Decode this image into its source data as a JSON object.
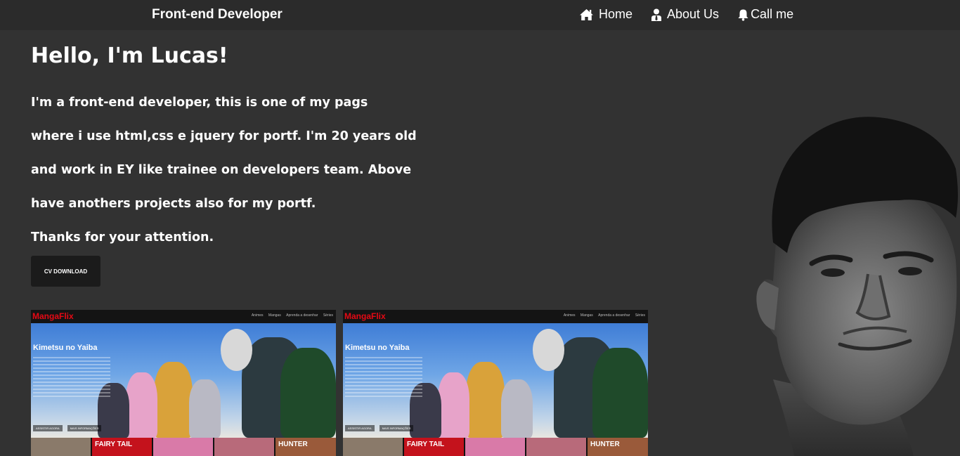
{
  "nav": {
    "brand": "Front-end Developer",
    "links": [
      {
        "label": "Home",
        "icon": "home-icon"
      },
      {
        "label": "About Us",
        "icon": "user-tie-icon"
      },
      {
        "label": "Call me",
        "icon": "bell-icon"
      }
    ]
  },
  "hero": {
    "title": "Hello, I'm Lucas!",
    "paragraph_lines": [
      "I'm a front-end developer, this is one of my pags",
      "where i use html,css e jquery for portf. I'm 20 years old",
      "and work in EY like trainee on developers team. Above",
      "have anothers projects also for my portf.",
      "Thanks for your attention."
    ],
    "cv_button_label": "CV DOWNLOAD"
  },
  "projects": [
    {
      "logo": "MangaFlix",
      "menu": [
        "Animes",
        "Mangas",
        "Aprenda a desenhar",
        "Séries"
      ],
      "hero_title": "Kimetsu no Yaiba",
      "buttons": [
        "ASSISTIR AGORA",
        "MAIS INFORMAÇÕES"
      ],
      "strip_labels": [
        "",
        "FAIRY TAIL",
        "",
        "",
        "HUNTER"
      ]
    },
    {
      "logo": "MangaFlix",
      "menu": [
        "Animes",
        "Mangas",
        "Aprenda a desenhar",
        "Séries"
      ],
      "hero_title": "Kimetsu no Yaiba",
      "buttons": [
        "ASSISTIR AGORA",
        "MAIS INFORMAÇÕES"
      ],
      "strip_labels": [
        "",
        "FAIRY TAIL",
        "",
        "",
        "HUNTER"
      ]
    }
  ],
  "colors": {
    "background": "#323232",
    "navbar": "#2b2b2b",
    "button": "#1b1b1b",
    "text": "#ffffff",
    "brand_red": "#e50914"
  }
}
